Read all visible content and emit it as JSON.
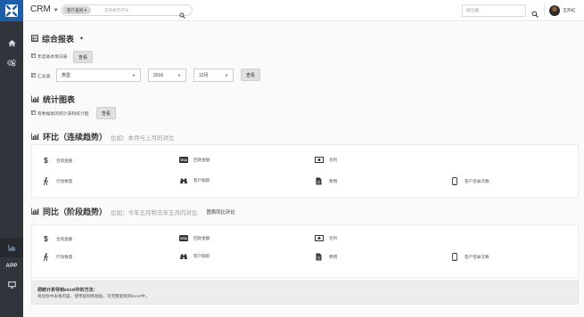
{
  "topbar": {
    "brand": "CRM",
    "scope_label": "客户查询",
    "search_placeholder": "支持拼音字头",
    "customer_placeholder": "找功能",
    "username": "王开虹",
    "icons": [
      "logo-icon",
      "caret-down-icon",
      "search-icon",
      "avatar"
    ]
  },
  "sidebar": {
    "items": [
      {
        "icon": "home-icon"
      },
      {
        "icon": "cogs-icon"
      },
      {
        "icon": "chart-icon"
      },
      {
        "label": "APP"
      },
      {
        "icon": "monitor-icon"
      }
    ]
  },
  "composite": {
    "title": "综合报表",
    "row1": {
      "label": "年度基本情况表",
      "button": "查看"
    },
    "row2": {
      "label": "汇总表",
      "type_value": "类型",
      "year_value": "2016",
      "month_value": "12月",
      "button": "查看"
    }
  },
  "stats": {
    "title": "统计图表",
    "row": {
      "label": "有数据类的统计表和统计图",
      "button": "查看"
    }
  },
  "mom": {
    "title": "环比（连续趋势）",
    "subtitle": "比如：本月与上月的对比",
    "metrics": [
      {
        "label": "合同金额",
        "icon": "dollar-icon"
      },
      {
        "label": "回款金额",
        "icon": "visa-card-icon"
      },
      {
        "label": "毛利",
        "icon": "money-icon"
      },
      {
        "label": "行动数量",
        "icon": "walking-icon"
      },
      {
        "label": "客户跟踪",
        "icon": "binoculars-icon"
      },
      {
        "label": "费用",
        "icon": "file-icon"
      },
      {
        "label": "客户登录次数",
        "icon": "mobile-icon"
      }
    ]
  },
  "yoy": {
    "title": "同比（阶段趋势）",
    "subtitle": "比如：今年五月和去年五月的对比",
    "toggle_label": "图表同比环比",
    "metrics": [
      {
        "label": "合同金额",
        "icon": "dollar-icon"
      },
      {
        "label": "回款金额",
        "icon": "visa-card-icon"
      },
      {
        "label": "毛利",
        "icon": "money-icon"
      },
      {
        "label": "行动数量",
        "icon": "walking-icon"
      },
      {
        "label": "客户跟踪",
        "icon": "binoculars-icon"
      },
      {
        "label": "费用",
        "icon": "file-icon"
      },
      {
        "label": "客户登录次数",
        "icon": "mobile-icon"
      }
    ]
  },
  "tip": {
    "title": "把统计表导到excel中的方法：",
    "body": "将鼠标中表格内容，使用复制和粘贴，可完整复制到excel中。"
  },
  "colors": {
    "sidebar": "#2f353b",
    "logo_bg": "#1e5ea8",
    "button_bg": "#e1e1e1",
    "tip_bg": "#ededed"
  }
}
